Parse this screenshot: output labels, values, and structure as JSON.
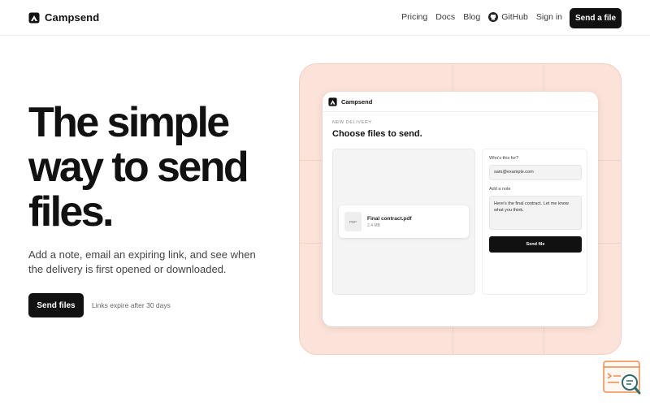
{
  "header": {
    "brand": "Campsend",
    "nav": {
      "pricing": "Pricing",
      "docs": "Docs",
      "blog": "Blog",
      "github": "GitHub",
      "signin": "Sign in"
    },
    "cta": "Send a file"
  },
  "hero": {
    "title": "The simple way to send files.",
    "subtitle": "Add a note, email an expiring link, and see when the delivery is first opened or downloaded.",
    "cta": "Send files",
    "note": "Links expire after 30 days"
  },
  "preview": {
    "brand": "Campsend",
    "eyebrow": "NEW DELIVERY",
    "title": "Choose files to send.",
    "file": {
      "thumb": "PDF",
      "name": "Final contract.pdf",
      "size": "2.4 MB"
    },
    "form": {
      "recipient_label": "Who's this for?",
      "recipient_value": "sam@example.com",
      "note_label": "Add a note",
      "note_value": "Here's the final contract. Let me know what you think.",
      "send": "Send file"
    }
  },
  "colors": {
    "accent": "#111111",
    "peach": "#fbe3d9",
    "widget": "#f08a4b",
    "widget_teal": "#2f6d6d"
  },
  "icons": {
    "brand": "campsend-logo-icon",
    "github": "github-icon",
    "widget": "search-panel-icon"
  }
}
